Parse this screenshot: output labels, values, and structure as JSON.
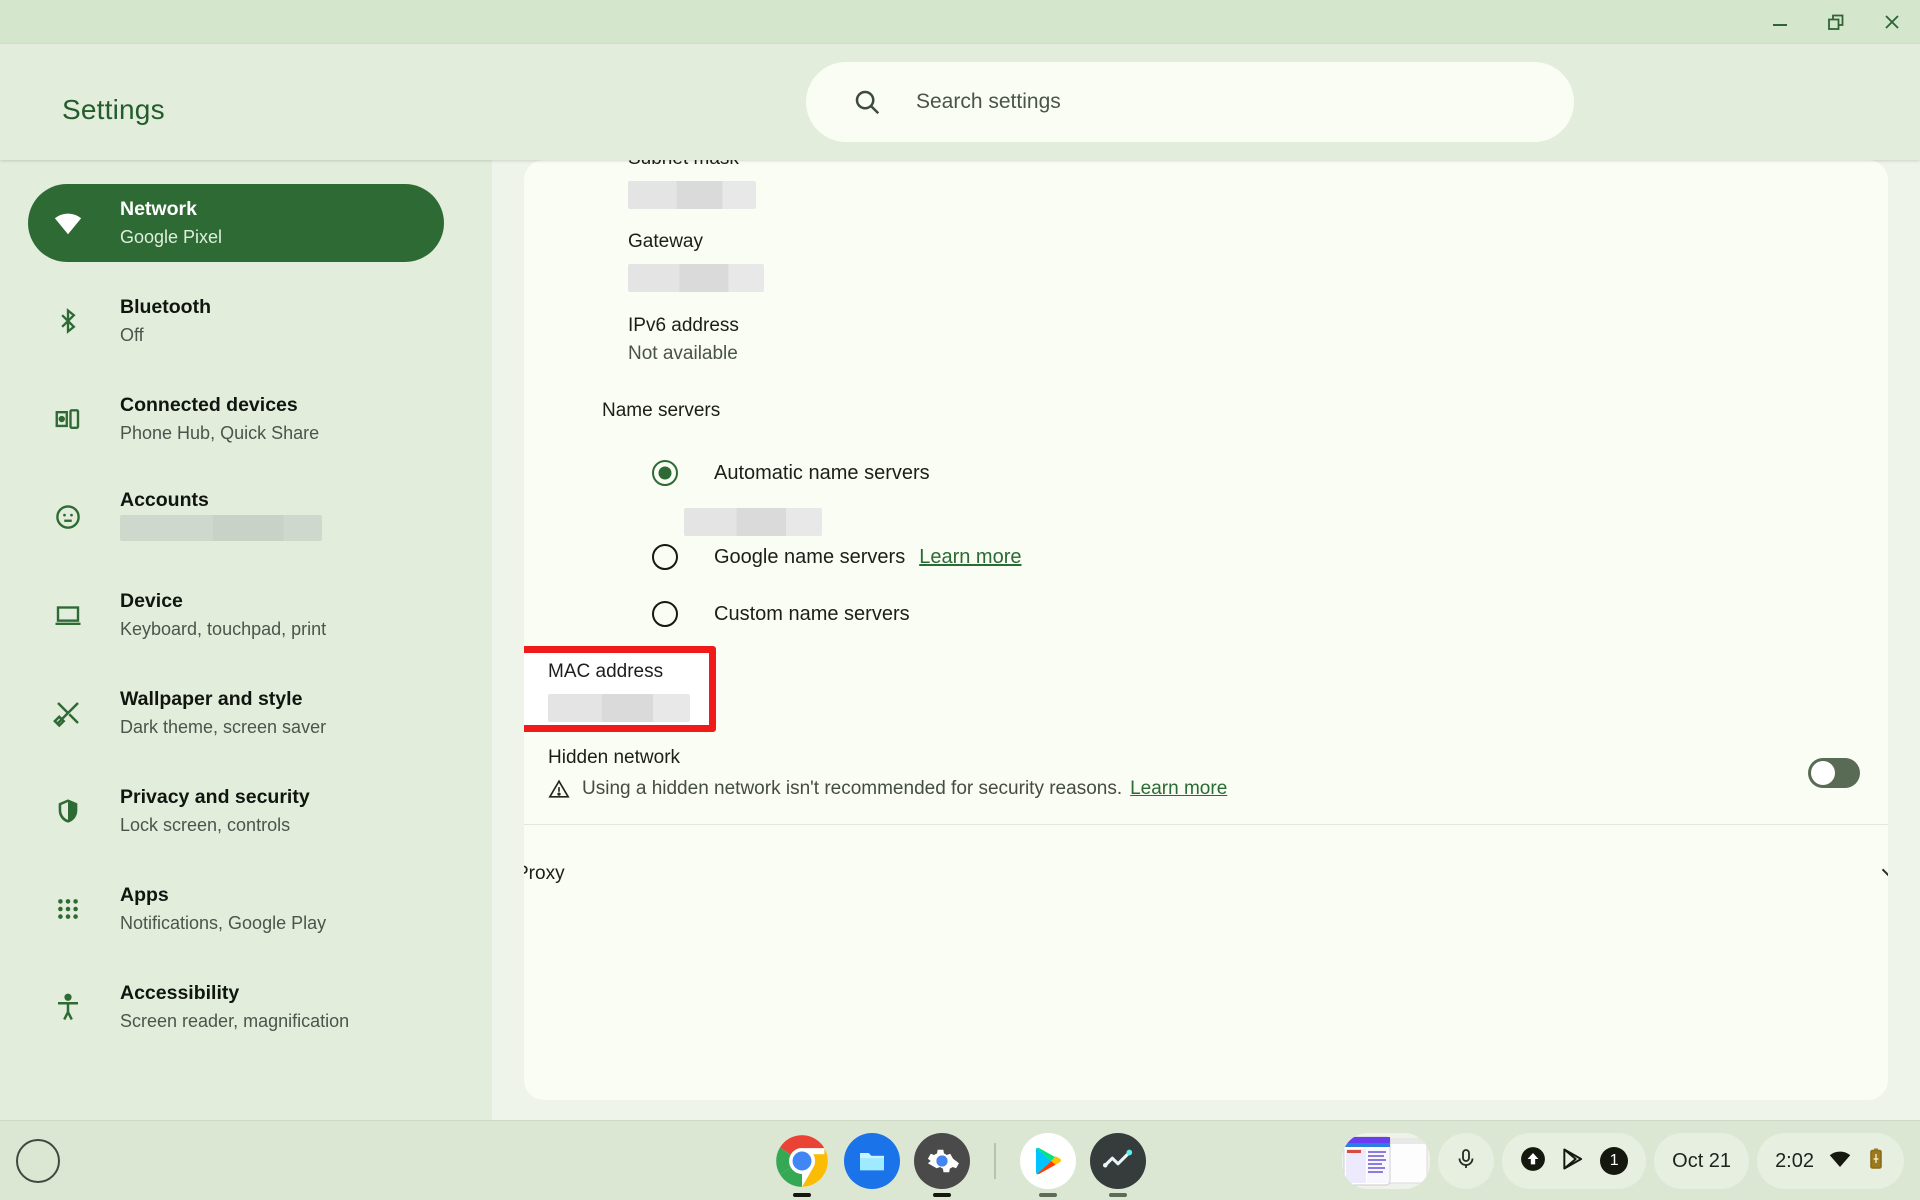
{
  "window": {
    "controls": [
      {
        "name": "minimize",
        "glyph": "minimize-icon"
      },
      {
        "name": "restore",
        "glyph": "restore-icon"
      },
      {
        "name": "close",
        "glyph": "close-icon"
      }
    ]
  },
  "header": {
    "title": "Settings",
    "search": {
      "placeholder": "Search settings",
      "value": "",
      "icon": "search-icon"
    }
  },
  "sidebar": {
    "items": [
      {
        "title": "Network",
        "sub": "Google Pixel",
        "icon": "wifi-icon",
        "selected": true,
        "redacted": false
      },
      {
        "title": "Bluetooth",
        "sub": "Off",
        "icon": "bluetooth-icon",
        "selected": false,
        "redacted": false
      },
      {
        "title": "Connected devices",
        "sub": "Phone Hub, Quick Share",
        "icon": "connected-devices-icon",
        "selected": false,
        "redacted": false
      },
      {
        "title": "Accounts",
        "sub": "",
        "icon": "account-icon",
        "selected": false,
        "redacted": true
      },
      {
        "title": "Device",
        "sub": "Keyboard, touchpad, print",
        "icon": "laptop-icon",
        "selected": false,
        "redacted": false
      },
      {
        "title": "Wallpaper and style",
        "sub": "Dark theme, screen saver",
        "icon": "wallpaper-style-icon",
        "selected": false,
        "redacted": false
      },
      {
        "title": "Privacy and security",
        "sub": "Lock screen, controls",
        "icon": "shield-icon",
        "selected": false,
        "redacted": false
      },
      {
        "title": "Apps",
        "sub": "Notifications, Google Play",
        "icon": "apps-grid-icon",
        "selected": false,
        "redacted": false
      },
      {
        "title": "Accessibility",
        "sub": "Screen reader, magnification",
        "icon": "accessibility-icon",
        "selected": false,
        "redacted": false
      }
    ]
  },
  "main": {
    "fields": {
      "subnet_mask_label": "Subnet mask",
      "subnet_mask_value": "",
      "gateway_label": "Gateway",
      "gateway_value": "",
      "ipv6_label": "IPv6 address",
      "ipv6_value": "Not available",
      "mac_label": "MAC address",
      "mac_value": ""
    },
    "name_servers": {
      "section_label": "Name servers",
      "options": [
        {
          "label": "Automatic name servers",
          "checked": true,
          "link": ""
        },
        {
          "label": "Google name servers",
          "checked": false,
          "link": "Learn more"
        },
        {
          "label": "Custom name servers",
          "checked": false,
          "link": ""
        }
      ]
    },
    "hidden_network": {
      "label": "Hidden network",
      "warning": "Using a hidden network isn't recommended for security reasons.",
      "link": "Learn more",
      "warn_icon": "warning-triangle-icon",
      "toggle_on": false
    },
    "proxy": {
      "label": "Proxy",
      "expand_icon": "chevron-down-icon"
    },
    "highlight_color": "#f01a1a"
  },
  "shelf": {
    "launcher": "launcher-circle-icon",
    "apps": [
      {
        "name": "chrome-icon",
        "active": true
      },
      {
        "name": "files-icon",
        "active": false
      },
      {
        "name": "settings-gear-icon",
        "active": true
      },
      {
        "name": "separator",
        "active": false
      },
      {
        "name": "play-store-icon",
        "active": true
      },
      {
        "name": "stock-chart-icon",
        "active": true
      }
    ],
    "status": {
      "preview": "window-preview-thumbnail",
      "mic_icon": "microphone-icon",
      "upload_icon": "upload-cloud-icon",
      "play_icon": "play-store-glyph-icon",
      "badge_count": "1",
      "date": "Oct 21",
      "time": "2:02",
      "wifi_icon": "wifi-status-icon",
      "battery_icon": "battery-charging-icon"
    }
  }
}
